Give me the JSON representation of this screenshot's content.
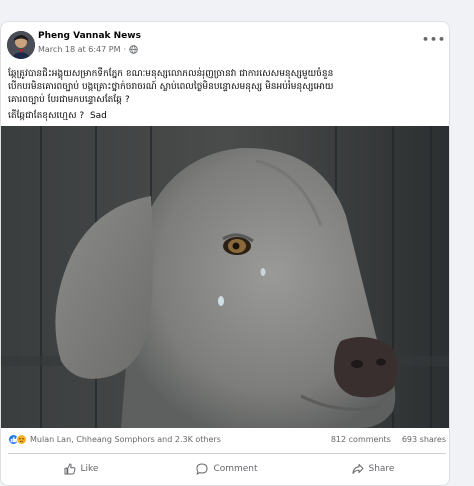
{
  "post": {
    "page_name": "Pheng Vannak News",
    "timestamp": "March 18 at 6:47 PM",
    "separator": "·",
    "more_label": "•••",
    "text_line1": "ឆ្កែត្រូវបានជិះអង្គុយសម្រាកទឹកភ្នែក ខណៈមនុស្សលោភលន់រុញច្រានវា ជាការសេសមនុស្សមួយចំនួន",
    "text_line2": "បើកបរមិនគោរពច្បាប់ បង្កគ្រោះថ្នាក់ចរាចរណ៍ ស្លាប់ពេលថ្ងៃមិនបន្ទោសមនុស្ស មិនអប់រំមនុស្សអោយ",
    "text_line3": "គោរពច្បាប់ បែរជាមកបន្ទោសតែឆ្កែ ?",
    "question": "តើឆ្កែជាតែខុសហ្មេស ?",
    "reaction_text": "Sad"
  },
  "stats": {
    "reactors": "Mulan Lan, Chheang Somphors and 2.3K others",
    "comments": "812 comments",
    "shares": "693 shares"
  },
  "actions": {
    "like": "Like",
    "comment": "Comment",
    "share": "Share"
  },
  "colors": {
    "brand_blue": "#1877f2",
    "sad_yellow": "#f7b125",
    "meta_gray": "#65676b"
  },
  "icons": [
    "globe-icon",
    "more-icon",
    "like-reaction-icon",
    "sad-reaction-icon",
    "like-icon",
    "comment-icon",
    "share-icon"
  ]
}
